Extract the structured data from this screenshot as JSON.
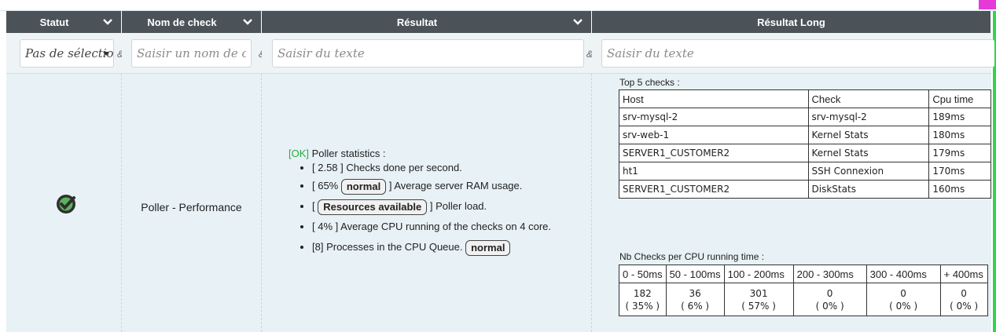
{
  "columns": {
    "statut": "Statut",
    "nom_check": "Nom de check",
    "resultat": "Résultat",
    "resultat_long": "Résultat Long"
  },
  "filters": {
    "statut_select": "Pas de sélection",
    "nom_placeholder": "Saisir un nom de check",
    "resultat_placeholder": "Saisir du texte",
    "long_placeholder": "Saisir du texte",
    "amp": "&"
  },
  "row": {
    "status_icon": "check-circle-icon",
    "check_name": "Poller - Performance",
    "result": {
      "ok_tag": "[OK]",
      "title": " Poller statistics :",
      "items": [
        {
          "pre": "[ 2.58 ] Checks done per second."
        },
        {
          "pre": "[ 65% ",
          "badge": "normal",
          "post": " ] Average server RAM usage."
        },
        {
          "pre": "[ ",
          "badge": "Resources available",
          "post": " ] Poller load."
        },
        {
          "pre": "[ 4% ] Average CPU running of the checks on 4 core."
        },
        {
          "pre": "[8] Processes in the CPU Queue. ",
          "badge": "normal"
        }
      ]
    },
    "long": {
      "top5_title": "Top 5 checks :",
      "top5_headers": [
        "Host",
        "Check",
        "Cpu time"
      ],
      "top5_rows": [
        [
          "srv-mysql-2",
          "srv-mysql-2",
          "189ms"
        ],
        [
          "srv-web-1",
          "Kernel Stats",
          "180ms"
        ],
        [
          "SERVER1_CUSTOMER2",
          "Kernel Stats",
          "179ms"
        ],
        [
          "ht1",
          "SSH Connexion",
          "170ms"
        ],
        [
          "SERVER1_CUSTOMER2",
          "DiskStats",
          "160ms"
        ]
      ],
      "nb_title": "Nb Checks per CPU running time :",
      "nb_headers": [
        "0 - 50ms",
        "50 - 100ms",
        "100 - 200ms",
        "200 - 300ms",
        "300 - 400ms",
        "+ 400ms"
      ],
      "nb_counts": [
        "182",
        "36",
        "301",
        "0",
        "0",
        "0"
      ],
      "nb_percents": [
        "( 35% )",
        "( 6% )",
        "( 57% )",
        "( 0% )",
        "( 0% )",
        "( 0% )"
      ]
    }
  },
  "colors": {
    "header_bg": "#4b5358",
    "row_bg": "#e8f1f5",
    "ok_green": "#2fa84a",
    "accent_pink": "#e63ad8",
    "edge_green": "#2ed84a"
  }
}
